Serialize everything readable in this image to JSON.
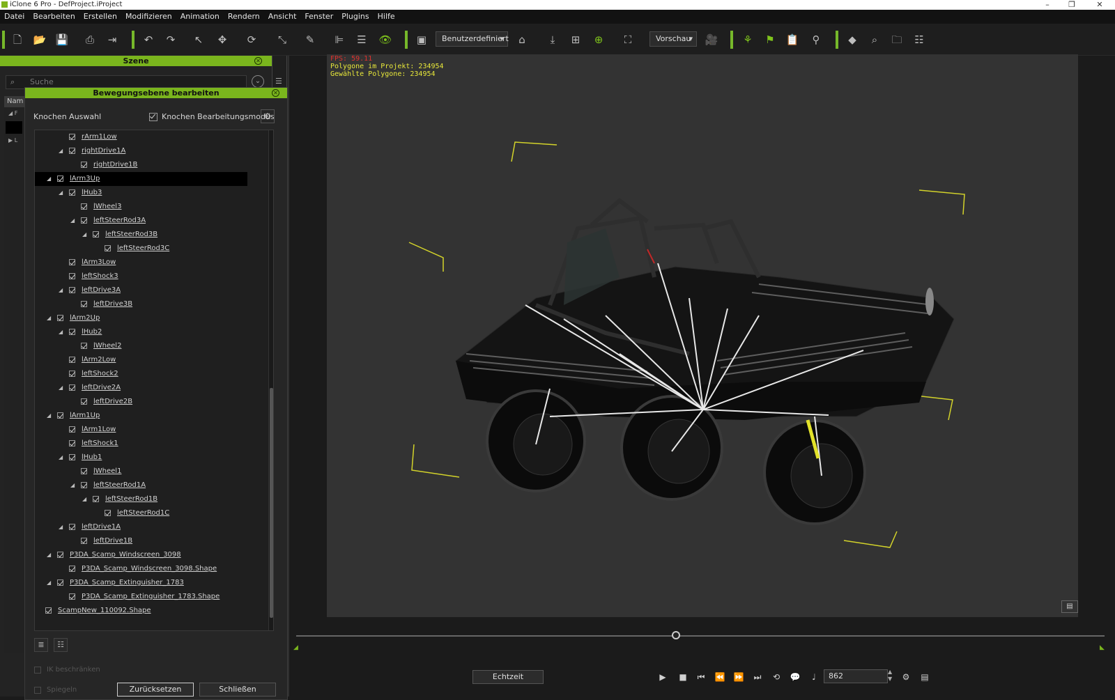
{
  "window": {
    "title": "iClone 6 Pro - DefProject.iProject"
  },
  "menu": [
    "Datei",
    "Bearbeiten",
    "Erstellen",
    "Modifizieren",
    "Animation",
    "Rendern",
    "Ansicht",
    "Fenster",
    "Plugins",
    "Hilfe"
  ],
  "toolbar": {
    "view_mode": "Benutzerdefiniert",
    "preview_mode": "Vorschau"
  },
  "scene_panel": {
    "title": "Szene",
    "search_placeholder": "Suche",
    "column_name": "Nam"
  },
  "motion_layer": {
    "title": "Bewegungsebene bearbeiten",
    "bone_selection_label": "Knochen Auswahl",
    "bone_edit_mode_label": "Knochen Bearbeitungsmodus",
    "bone_edit_mode_checked": true,
    "tree": [
      {
        "name": "rArm1Low",
        "depth": 3,
        "expand": false,
        "selected": false
      },
      {
        "name": "rightDrive1A",
        "depth": 3,
        "expand": true,
        "selected": false
      },
      {
        "name": "rightDrive1B",
        "depth": 4,
        "expand": false,
        "selected": false
      },
      {
        "name": "lArm3Up",
        "depth": 2,
        "expand": true,
        "selected": true
      },
      {
        "name": "lHub3",
        "depth": 3,
        "expand": true,
        "selected": false
      },
      {
        "name": "lWheel3",
        "depth": 4,
        "expand": false,
        "selected": false
      },
      {
        "name": "leftSteerRod3A",
        "depth": 4,
        "expand": true,
        "selected": false
      },
      {
        "name": "leftSteerRod3B",
        "depth": 5,
        "expand": true,
        "selected": false
      },
      {
        "name": "leftSteerRod3C",
        "depth": 6,
        "expand": false,
        "selected": false
      },
      {
        "name": "lArm3Low",
        "depth": 3,
        "expand": false,
        "selected": false
      },
      {
        "name": "leftShock3",
        "depth": 3,
        "expand": false,
        "selected": false
      },
      {
        "name": "leftDrive3A",
        "depth": 3,
        "expand": true,
        "selected": false
      },
      {
        "name": "leftDrive3B",
        "depth": 4,
        "expand": false,
        "selected": false
      },
      {
        "name": "lArm2Up",
        "depth": 2,
        "expand": true,
        "selected": false
      },
      {
        "name": "lHub2",
        "depth": 3,
        "expand": true,
        "selected": false
      },
      {
        "name": "lWheel2",
        "depth": 4,
        "expand": false,
        "selected": false
      },
      {
        "name": "lArm2Low",
        "depth": 3,
        "expand": false,
        "selected": false
      },
      {
        "name": "leftShock2",
        "depth": 3,
        "expand": false,
        "selected": false
      },
      {
        "name": "leftDrive2A",
        "depth": 3,
        "expand": true,
        "selected": false
      },
      {
        "name": "leftDrive2B",
        "depth": 4,
        "expand": false,
        "selected": false
      },
      {
        "name": "lArm1Up",
        "depth": 2,
        "expand": true,
        "selected": false
      },
      {
        "name": "lArm1Low",
        "depth": 3,
        "expand": false,
        "selected": false
      },
      {
        "name": "leftShock1",
        "depth": 3,
        "expand": false,
        "selected": false
      },
      {
        "name": "lHub1",
        "depth": 3,
        "expand": true,
        "selected": false
      },
      {
        "name": "lWheel1",
        "depth": 4,
        "expand": false,
        "selected": false
      },
      {
        "name": "leftSteerRod1A",
        "depth": 4,
        "expand": true,
        "selected": false
      },
      {
        "name": "leftSteerRod1B",
        "depth": 5,
        "expand": true,
        "selected": false
      },
      {
        "name": "leftSteerRod1C",
        "depth": 6,
        "expand": false,
        "selected": false
      },
      {
        "name": "leftDrive1A",
        "depth": 3,
        "expand": true,
        "selected": false
      },
      {
        "name": "leftDrive1B",
        "depth": 4,
        "expand": false,
        "selected": false
      },
      {
        "name": "P3DA_Scamp_Windscreen_3098",
        "depth": 2,
        "expand": true,
        "selected": false
      },
      {
        "name": "P3DA_Scamp_Windscreen_3098.Shape",
        "depth": 3,
        "expand": false,
        "selected": false
      },
      {
        "name": "P3DA_Scamp_Extinguisher_1783",
        "depth": 2,
        "expand": true,
        "selected": false
      },
      {
        "name": "P3DA_Scamp_Extinguisher_1783.Shape",
        "depth": 3,
        "expand": false,
        "selected": false
      },
      {
        "name": "ScampNew_110092.Shape",
        "depth": 1,
        "expand": false,
        "selected": false
      }
    ],
    "ik_limit_label": "IK beschränken",
    "mirror_label": "Spiegeln",
    "reset_button": "Zurücksetzen",
    "close_button": "Schließen"
  },
  "viewport": {
    "fps": "FPS: 59.11",
    "polygons_project": "Polygone im Projekt: 234954",
    "polygons_selected": "Gewählte Polygone: 234954"
  },
  "playback": {
    "realtime_button": "Echtzeit",
    "frame": "862",
    "position_fraction": 0.47
  },
  "colors": {
    "accent": "#7ab51d",
    "fps": "#e0322e",
    "stats": "#e8e83a",
    "bone_lines": "#e8e8e8",
    "markers": "#d4d42a"
  }
}
